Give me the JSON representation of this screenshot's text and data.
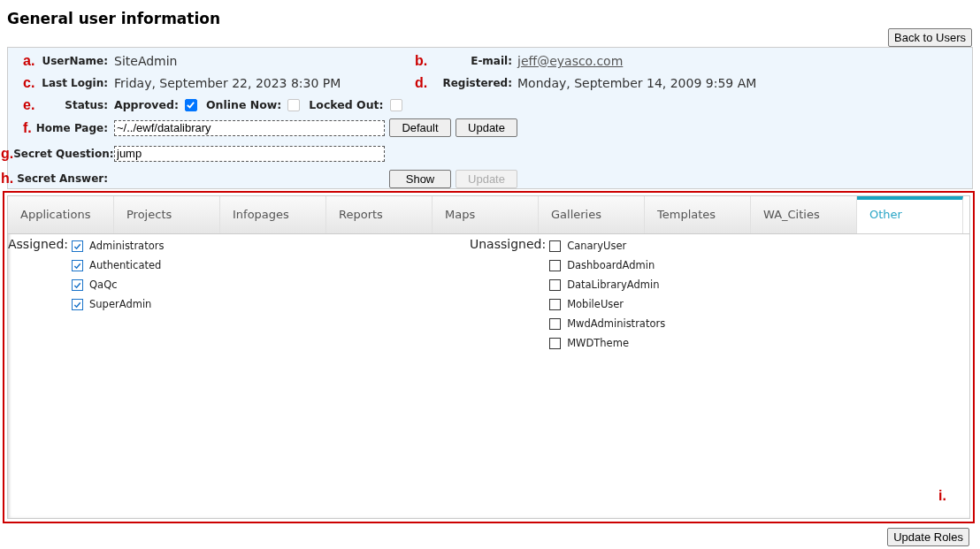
{
  "title": "General user information",
  "back_button": "Back to Users",
  "info": {
    "username": {
      "marker": "a.",
      "label": "UserName:",
      "value": "SiteAdmin"
    },
    "email": {
      "marker": "b.",
      "label": "E-mail:",
      "value": "jeff@eyasco.com"
    },
    "last_login": {
      "marker": "c.",
      "label": "Last Login:",
      "value": "Friday, September 22, 2023 8:30 PM"
    },
    "registered": {
      "marker": "d.",
      "label": "Registered:",
      "value": "Monday, September 14, 2009 9:59 AM"
    },
    "status": {
      "marker": "e.",
      "label": "Status:",
      "flags": [
        {
          "label": "Approved:",
          "checked": true,
          "disabled": false
        },
        {
          "label": "Online Now:",
          "checked": false,
          "disabled": true
        },
        {
          "label": "Locked Out:",
          "checked": false,
          "disabled": true
        }
      ]
    },
    "home_page": {
      "marker": "f.",
      "label": "Home Page:",
      "value": "~/../ewf/datalibrary",
      "buttons": [
        {
          "label": "Default",
          "disabled": false
        },
        {
          "label": "Update",
          "disabled": false
        }
      ]
    },
    "secret_question": {
      "marker": "g.",
      "label": "Secret Question:",
      "value": "jump"
    },
    "secret_answer": {
      "marker": "h.",
      "label": "Secret Answer:",
      "buttons": [
        {
          "label": "Show",
          "disabled": false
        },
        {
          "label": "Update",
          "disabled": true
        }
      ]
    }
  },
  "roles": {
    "tabs": [
      {
        "label": "Applications",
        "selected": false
      },
      {
        "label": "Projects",
        "selected": false
      },
      {
        "label": "Infopages",
        "selected": false
      },
      {
        "label": "Reports",
        "selected": false
      },
      {
        "label": "Maps",
        "selected": false
      },
      {
        "label": "Galleries",
        "selected": false
      },
      {
        "label": "Templates",
        "selected": false
      },
      {
        "label": "WA_Cities",
        "selected": false
      },
      {
        "label": "Other",
        "selected": true
      }
    ],
    "assigned_label": "Assigned:",
    "assigned": [
      {
        "label": "Administrators",
        "checked": true
      },
      {
        "label": "Authenticated",
        "checked": true
      },
      {
        "label": "QaQc",
        "checked": true
      },
      {
        "label": "SuperAdmin",
        "checked": true
      }
    ],
    "unassigned_label": "Unassigned:",
    "unassigned": [
      {
        "label": "CanaryUser",
        "checked": false
      },
      {
        "label": "DashboardAdmin",
        "checked": false
      },
      {
        "label": "DataLibraryAdmin",
        "checked": false
      },
      {
        "label": "MobileUser",
        "checked": false
      },
      {
        "label": "MwdAdministrators",
        "checked": false
      },
      {
        "label": "MWDTheme",
        "checked": false
      }
    ],
    "marker": "i."
  },
  "update_roles_button": "Update Roles"
}
